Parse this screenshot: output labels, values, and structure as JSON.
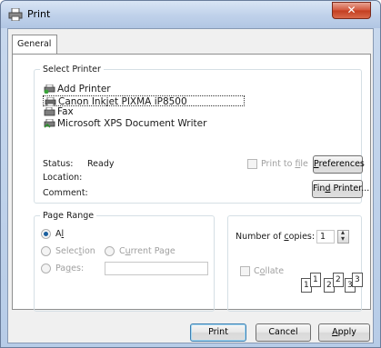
{
  "window": {
    "title": "Print",
    "close_glyph": "✕"
  },
  "tabs": [
    {
      "label": "General"
    }
  ],
  "select_printer": {
    "legend": "Select Printer",
    "printers": [
      {
        "name": "Add Printer",
        "icon": "add-printer-icon",
        "selected": false
      },
      {
        "name": "Canon Inkjet PIXMA iP8500",
        "icon": "printer-icon",
        "selected": true
      },
      {
        "name": "Fax",
        "icon": "fax-icon",
        "selected": false
      },
      {
        "name": "Microsoft XPS Document Writer",
        "icon": "xps-printer-icon",
        "selected": false
      }
    ],
    "status_label": "Status:",
    "status_value": "Ready",
    "location_label": "Location:",
    "comment_label": "Comment:",
    "print_to_file": {
      "pre": "Print to ",
      "mnemonic": "f",
      "post": "ile",
      "checked": false
    },
    "preferences": {
      "mnemonic": "P",
      "post": "references"
    },
    "find_printer": {
      "pre": "Fin",
      "mnemonic": "d",
      "post": " Printer..."
    }
  },
  "page_range": {
    "legend": "Page Range",
    "all": {
      "mnemonic": "l",
      "pre": "A",
      "post": "",
      "checked": true
    },
    "selection": {
      "pre": "Selec",
      "mnemonic": "t",
      "post": "ion"
    },
    "current_page": {
      "pre": "C",
      "mnemonic": "u",
      "post": "rrent Page"
    },
    "pages": {
      "pre": "Pa",
      "mnemonic": "g",
      "post": "es:",
      "value": ""
    }
  },
  "copies": {
    "label_pre": "Number of ",
    "label_mnemonic": "c",
    "label_post": "opies:",
    "value": "1",
    "collate": {
      "pre": "C",
      "mnemonic": "o",
      "post": "llate",
      "checked": false
    },
    "pages_illustration": [
      "1",
      "1",
      "2",
      "2",
      "3",
      "3"
    ]
  },
  "buttons": {
    "print": "Print",
    "cancel": "Cancel",
    "apply_mnemonic": "A",
    "apply_post": "pply"
  },
  "colors": {
    "accent": "#3c7fb1",
    "disabled_text": "#a0a0a0",
    "window_frame": "#b7cce7"
  }
}
